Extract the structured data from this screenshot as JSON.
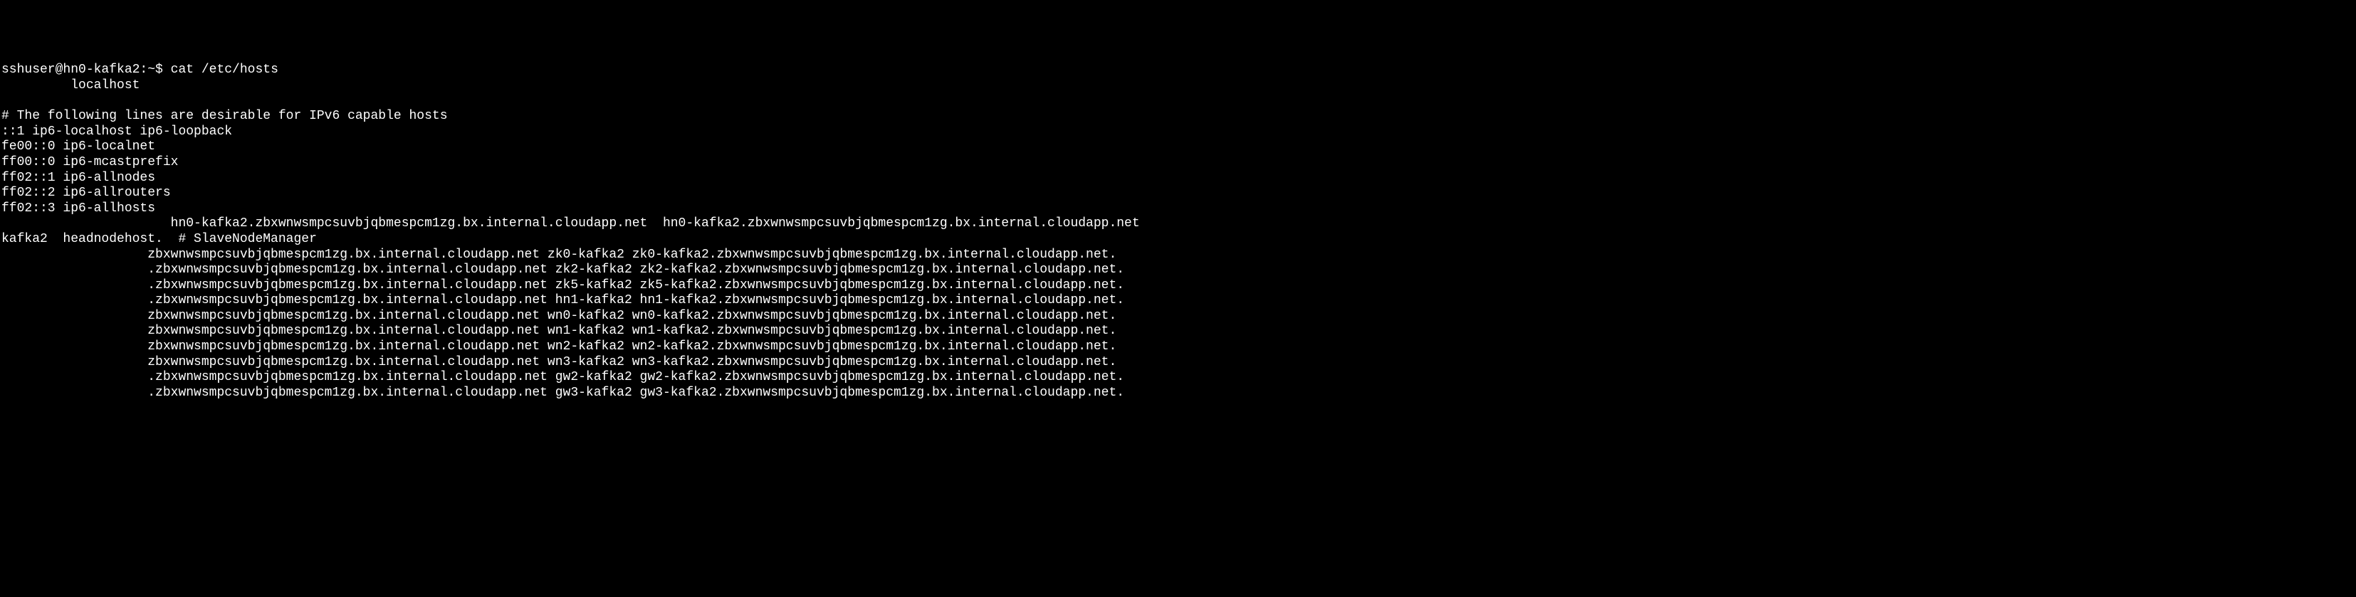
{
  "terminal": {
    "prompt": "sshuser@hn0-kafka2:~$ ",
    "command": "cat /etc/hosts",
    "lines": [
      "         localhost",
      "",
      "# The following lines are desirable for IPv6 capable hosts",
      "::1 ip6-localhost ip6-loopback",
      "fe00::0 ip6-localnet",
      "ff00::0 ip6-mcastprefix",
      "ff02::1 ip6-allnodes",
      "ff02::2 ip6-allrouters",
      "ff02::3 ip6-allhosts",
      "                      hn0-kafka2.zbxwnwsmpcsuvbjqbmespcm1zg.bx.internal.cloudapp.net  hn0-kafka2.zbxwnwsmpcsuvbjqbmespcm1zg.bx.internal.cloudapp.net",
      "kafka2  headnodehost.  # SlaveNodeManager",
      "                   zbxwnwsmpcsuvbjqbmespcm1zg.bx.internal.cloudapp.net zk0-kafka2 zk0-kafka2.zbxwnwsmpcsuvbjqbmespcm1zg.bx.internal.cloudapp.net.",
      "                   .zbxwnwsmpcsuvbjqbmespcm1zg.bx.internal.cloudapp.net zk2-kafka2 zk2-kafka2.zbxwnwsmpcsuvbjqbmespcm1zg.bx.internal.cloudapp.net.",
      "                   .zbxwnwsmpcsuvbjqbmespcm1zg.bx.internal.cloudapp.net zk5-kafka2 zk5-kafka2.zbxwnwsmpcsuvbjqbmespcm1zg.bx.internal.cloudapp.net.",
      "                   .zbxwnwsmpcsuvbjqbmespcm1zg.bx.internal.cloudapp.net hn1-kafka2 hn1-kafka2.zbxwnwsmpcsuvbjqbmespcm1zg.bx.internal.cloudapp.net.",
      "                   zbxwnwsmpcsuvbjqbmespcm1zg.bx.internal.cloudapp.net wn0-kafka2 wn0-kafka2.zbxwnwsmpcsuvbjqbmespcm1zg.bx.internal.cloudapp.net.",
      "                   zbxwnwsmpcsuvbjqbmespcm1zg.bx.internal.cloudapp.net wn1-kafka2 wn1-kafka2.zbxwnwsmpcsuvbjqbmespcm1zg.bx.internal.cloudapp.net.",
      "                   zbxwnwsmpcsuvbjqbmespcm1zg.bx.internal.cloudapp.net wn2-kafka2 wn2-kafka2.zbxwnwsmpcsuvbjqbmespcm1zg.bx.internal.cloudapp.net.",
      "                   zbxwnwsmpcsuvbjqbmespcm1zg.bx.internal.cloudapp.net wn3-kafka2 wn3-kafka2.zbxwnwsmpcsuvbjqbmespcm1zg.bx.internal.cloudapp.net.",
      "                   .zbxwnwsmpcsuvbjqbmespcm1zg.bx.internal.cloudapp.net gw2-kafka2 gw2-kafka2.zbxwnwsmpcsuvbjqbmespcm1zg.bx.internal.cloudapp.net.",
      "                   .zbxwnwsmpcsuvbjqbmespcm1zg.bx.internal.cloudapp.net gw3-kafka2 gw3-kafka2.zbxwnwsmpcsuvbjqbmespcm1zg.bx.internal.cloudapp.net."
    ]
  }
}
